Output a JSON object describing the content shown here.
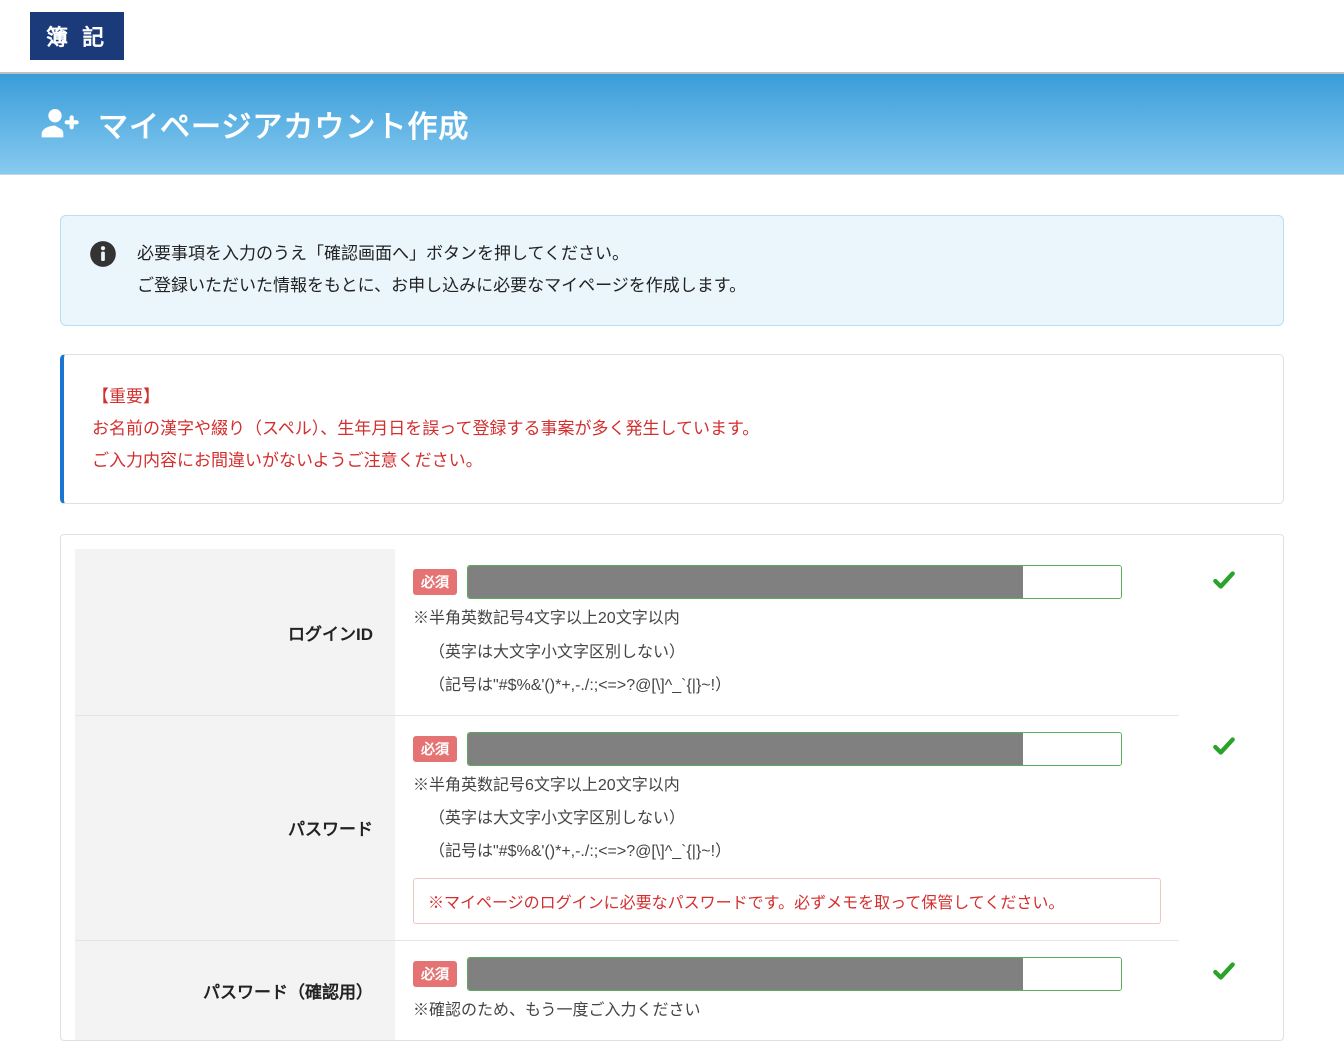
{
  "header": {
    "logo": "簿 記",
    "page_title": "マイページアカウント作成"
  },
  "info": {
    "line1": "必要事項を入力のうえ「確認画面へ」ボタンを押してください。",
    "line2": "ご登録いただいた情報をもとに、お申し込みに必要なマイページを作成します。"
  },
  "warning": {
    "title": "【重要】",
    "line1": "お名前の漢字や綴り（スペル）、生年月日を誤って登録する事案が多く発生しています。",
    "line2": "ご入力内容にお間違いがないようご注意ください。"
  },
  "form": {
    "required_label": "必須",
    "login_id": {
      "label": "ログインID",
      "hint1": "※半角英数記号4文字以上20文字以内",
      "hint2": "（英字は大文字小文字区別しない）",
      "hint3": "（記号は\"#$%&'()*+,-./:;<=>?@[\\]^_`{|}~!）"
    },
    "password": {
      "label": "パスワード",
      "hint1": "※半角英数記号6文字以上20文字以内",
      "hint2": "（英字は大文字小文字区別しない）",
      "hint3": "（記号は\"#$%&'()*+,-./:;<=>?@[\\]^_`{|}~!）",
      "warning": "※マイページのログインに必要なパスワードです。必ずメモを取って保管してください。"
    },
    "password_confirm": {
      "label": "パスワード（確認用）",
      "hint1": "※確認のため、もう一度ご入力ください"
    }
  }
}
